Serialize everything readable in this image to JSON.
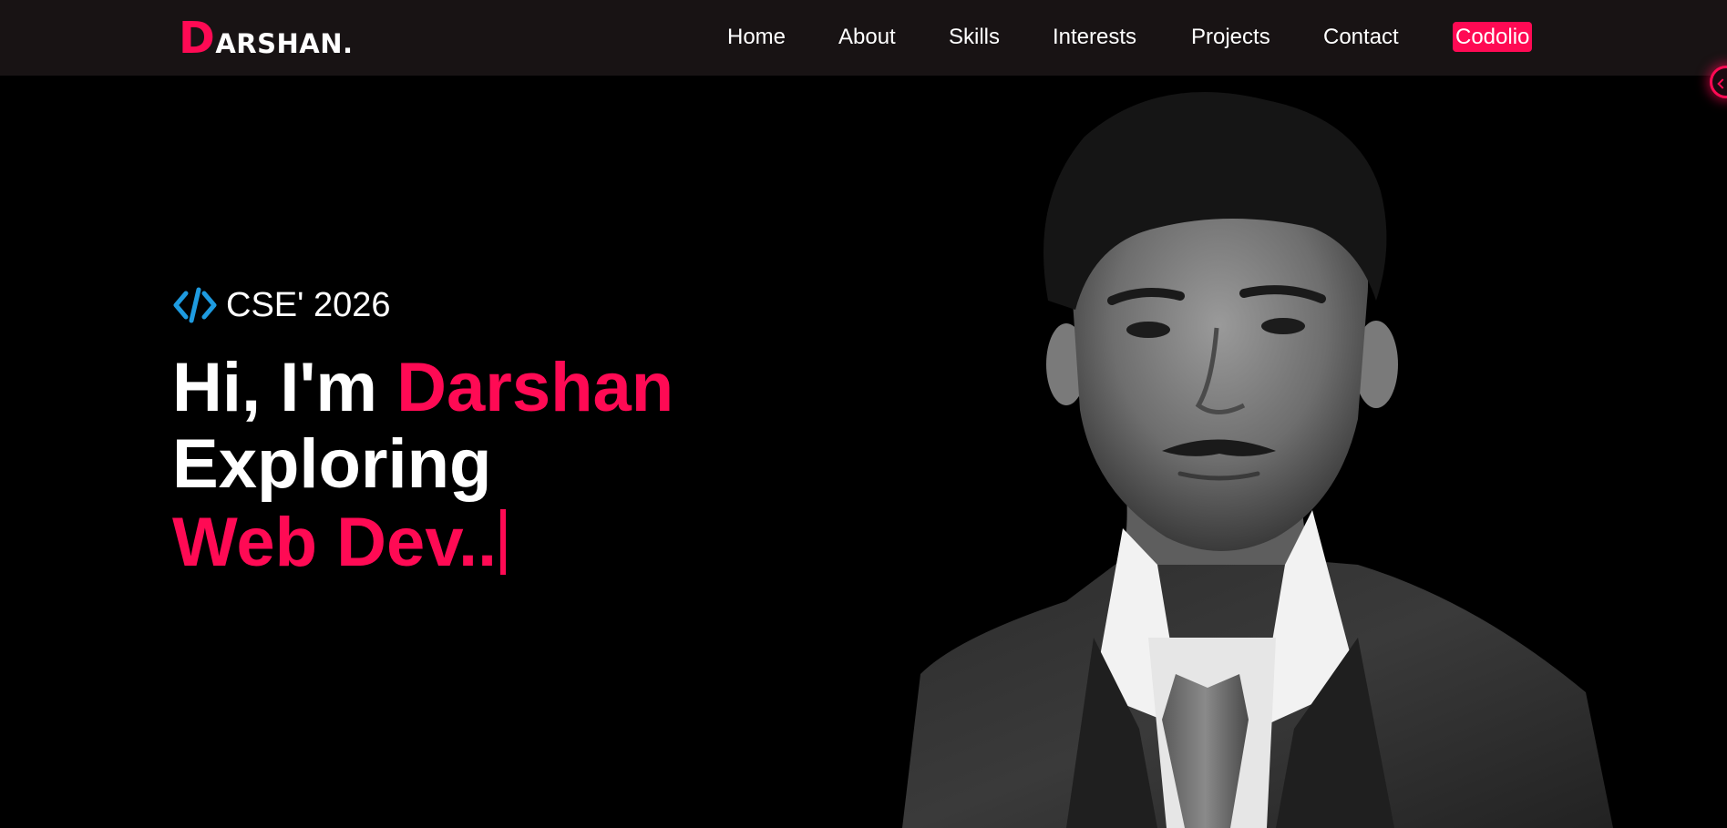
{
  "brand": {
    "initial": "D",
    "rest": "ARSHAN."
  },
  "nav": {
    "items": [
      {
        "label": "Home"
      },
      {
        "label": "About"
      },
      {
        "label": "Skills"
      },
      {
        "label": "Interests"
      },
      {
        "label": "Projects"
      },
      {
        "label": "Contact"
      },
      {
        "label": "Codolio"
      }
    ]
  },
  "hero": {
    "tag_icon": "code-icon",
    "tag": "CSE' 2026",
    "greeting": "Hi, I'm ",
    "name": "Darshan",
    "line2": "Exploring",
    "line3": "Web Dev..",
    "cursor": "|"
  },
  "portrait": {
    "icon": "profile-photo"
  },
  "colors": {
    "accent": "#ff0a54",
    "header_bg": "#181314",
    "page_bg": "#000000",
    "code_icon": "#1e9be0"
  }
}
